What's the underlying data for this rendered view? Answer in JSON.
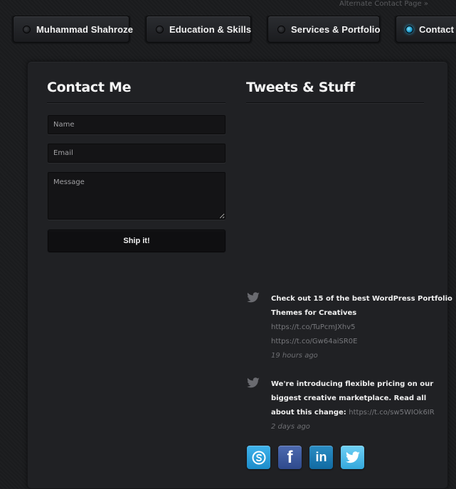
{
  "header": {
    "alt_link": "Alternate Contact Page »"
  },
  "nav": {
    "items": [
      {
        "label": "Muhammad Shahroze",
        "active": false
      },
      {
        "label": "Education & Skills",
        "active": false
      },
      {
        "label": "Services & Portfolio",
        "active": false
      },
      {
        "label": "Contact",
        "active": true
      }
    ]
  },
  "contact": {
    "title": "Contact Me",
    "name_placeholder": "Name",
    "email_placeholder": "Email",
    "message_placeholder": "Message",
    "submit_label": "Ship it!"
  },
  "tweets": {
    "title": "Tweets & Stuff",
    "items": [
      {
        "line1": "Check out 15 of the best WordPress Portfolio",
        "line2": "Themes for Creatives",
        "link1": "https://t.co/TuPcmJXhv5",
        "link2": "https://t.co/Gw64aiSR0E",
        "time": "19 hours ago"
      },
      {
        "line1": "We're introducing flexible pricing on our",
        "line2": "biggest creative marketplace. Read all",
        "line3": "about this change:",
        "link1": "https://t.co/sw5WIOk6IR",
        "time": "2 days ago"
      }
    ]
  },
  "social": {
    "facebook_glyph": "f",
    "linkedin_glyph": "in"
  },
  "colors": {
    "accent": "#2bb8f0",
    "background": "#1b1c1e",
    "panel": "#202124"
  }
}
